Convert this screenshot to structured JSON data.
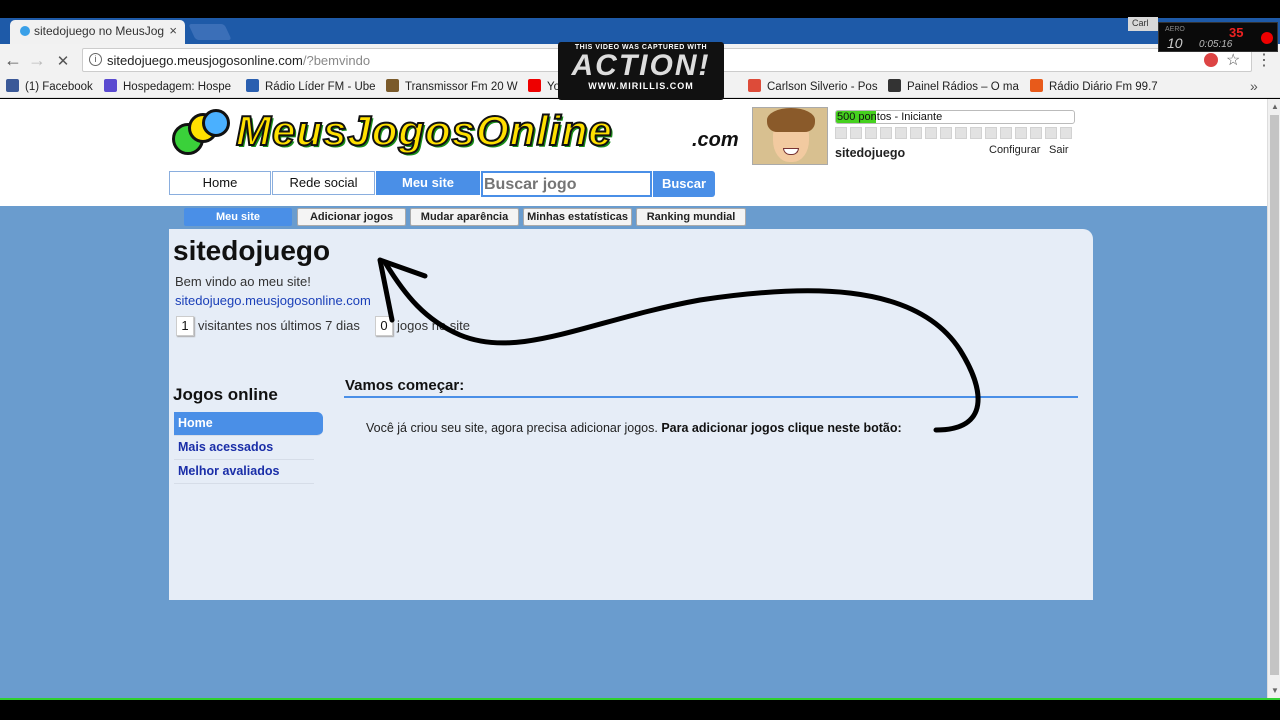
{
  "browser": {
    "tab_title": "sitedojuego no MeusJog",
    "tab_close": "×",
    "corner_text": "Carl",
    "url_main": "sitedojuego.meusjogosonline.com",
    "url_rest": "/?bemvindo",
    "back_glyph": "←",
    "forward_glyph": "→",
    "reload_glyph": "✕",
    "info_glyph": "i",
    "star_glyph": "☆",
    "menu_glyph": "⋮",
    "more_glyph": "»",
    "bookmarks": [
      {
        "label": "(1) Facebook",
        "icon": "facebook-icon",
        "color": "#3b5998"
      },
      {
        "label": "Hospedagem: Hospe",
        "icon": "hosting-icon",
        "color": "#5a4ad0"
      },
      {
        "label": "Rádio Líder FM - Ube",
        "icon": "radio-r-icon",
        "color": "#2a5fb0"
      },
      {
        "label": "Transmissor Fm 20 W",
        "icon": "transmitter-icon",
        "color": "#7a5a2a"
      },
      {
        "label": "YouTube",
        "icon": "youtube-icon",
        "color": "#e00"
      },
      {
        "label": "Carlson Silverio - Pos",
        "icon": "google-plus-icon",
        "color": "#dd4b39"
      },
      {
        "label": "Painel Rádios – O ma",
        "icon": "wordpress-icon",
        "color": "#333"
      },
      {
        "label": "Rádio Diário Fm 99.7",
        "icon": "radio-diario-icon",
        "color": "#e85a1a"
      }
    ]
  },
  "overlay": {
    "captured": "THIS VIDEO WAS CAPTURED WITH",
    "brand": "ACTION!",
    "site": "WWW.MIRILLIS.COM",
    "aero": "AERO",
    "fps": "10",
    "counter": "35",
    "time": "0:05:16"
  },
  "site": {
    "logo_text": "MeusJogosOnline",
    "logo_com": ".com",
    "points_text": "500 pontos - Iniciante",
    "points_fraction": 0.17,
    "level_squares": 16,
    "username": "sitedojuego",
    "configure": "Configurar",
    "logout": "Sair",
    "nav": [
      "Home",
      "Rede social",
      "Meu site"
    ],
    "nav_active": 2,
    "search_placeholder": "Buscar jogo",
    "search_button": "Buscar",
    "subtabs": [
      "Meu site",
      "Adicionar jogos",
      "Mudar aparência",
      "Minhas estatísticas",
      "Ranking mundial"
    ],
    "subtab_active": 0
  },
  "main": {
    "site_title": "sitedojuego",
    "welcome": "Bem vindo ao meu site!",
    "site_link": "sitedojuego.meusjogosonline.com",
    "visitors_count": "1",
    "visitors_label": "visitantes nos últimos 7 dias",
    "games_count": "0",
    "games_label": "jogos no site",
    "jogos_title": "Jogos online",
    "menu": [
      "Home",
      "Mais acessados",
      "Melhor avaliados"
    ],
    "menu_active": 0,
    "section_title": "Vamos começar:",
    "message": "Você já criou seu site, agora precisa adicionar jogos.",
    "message_bold": "Para adicionar jogos clique neste botão:"
  }
}
